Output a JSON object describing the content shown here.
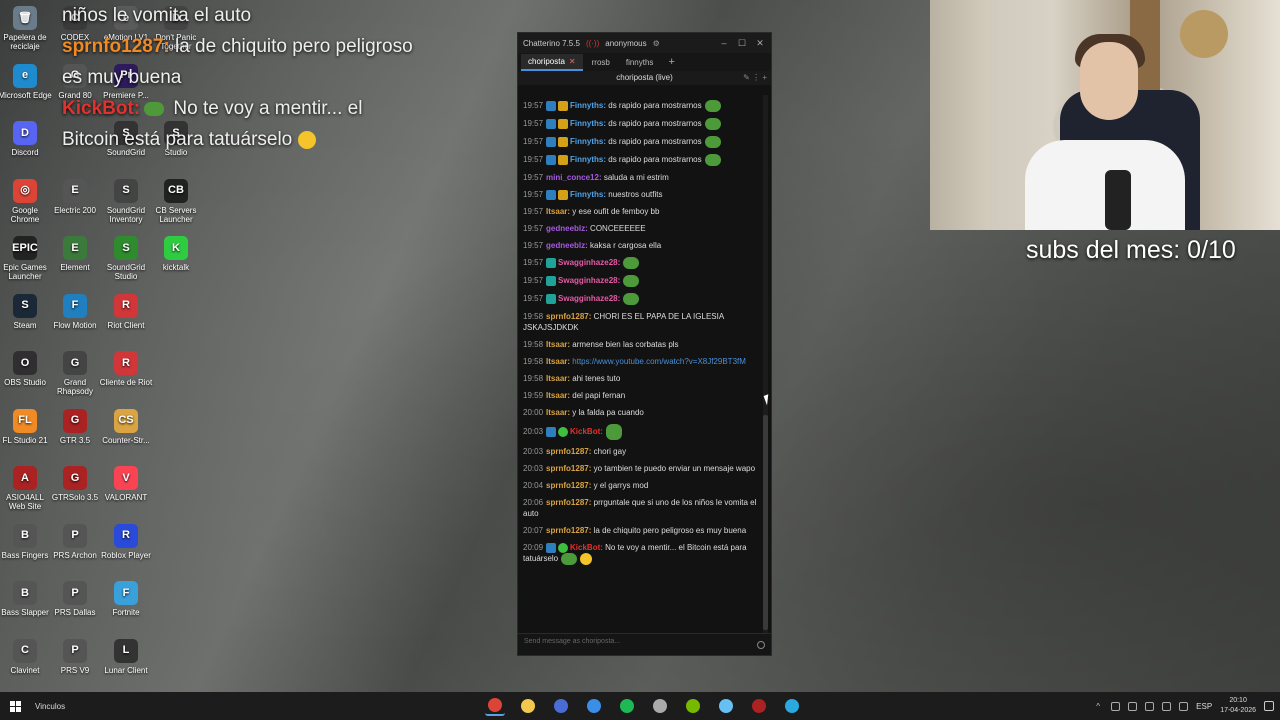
{
  "desktop_icons": [
    {
      "label": "Papelera de reciclaje",
      "color": "#6a7c8a",
      "glyph": "🗑"
    },
    {
      "label": "CODEX",
      "color": "#3a3a3a",
      "glyph": "C"
    },
    {
      "label": "eMotion LV1",
      "color": "#5a5a5a",
      "glyph": "e"
    },
    {
      "label": "Don't Panic Together",
      "color": "#444",
      "glyph": "D"
    },
    {
      "label": "Microsoft Edge",
      "color": "#1f8bcf",
      "glyph": "e"
    },
    {
      "label": "Grand 80",
      "color": "#555",
      "glyph": "G"
    },
    {
      "label": "Premiere P...",
      "color": "#2d1b5c",
      "glyph": "Pr"
    },
    {
      "label": "Discord",
      "color": "#5865f2",
      "glyph": "D"
    },
    {
      "label": "SoundGrid",
      "color": "#333",
      "glyph": "S"
    },
    {
      "label": "Studio",
      "color": "#333",
      "glyph": "S"
    },
    {
      "label": "Google Chrome",
      "color": "#db4437",
      "glyph": "◎"
    },
    {
      "label": "Electric 200",
      "color": "#555",
      "glyph": "E"
    },
    {
      "label": "SoundGrid Inventory",
      "color": "#444",
      "glyph": "S"
    },
    {
      "label": "CB Servers Launcher",
      "color": "#222",
      "glyph": "CB"
    },
    {
      "label": "Epic Games Launcher",
      "color": "#222",
      "glyph": "EPIC"
    },
    {
      "label": "Element",
      "color": "#3c7a3c",
      "glyph": "E"
    },
    {
      "label": "SoundGrid Studio",
      "color": "#2e8b2e",
      "glyph": "S"
    },
    {
      "label": "kicktalk",
      "color": "#2ecc40",
      "glyph": "K"
    },
    {
      "label": "Steam",
      "color": "#1b2838",
      "glyph": "S"
    },
    {
      "label": "Flow Motion",
      "color": "#1f7fbf",
      "glyph": "F"
    },
    {
      "label": "Riot Client",
      "color": "#d13639",
      "glyph": "R"
    },
    {
      "label": "OBS Studio",
      "color": "#302e31",
      "glyph": "O"
    },
    {
      "label": "Grand Rhapsody",
      "color": "#444",
      "glyph": "G"
    },
    {
      "label": "Cliente de Riot",
      "color": "#d13639",
      "glyph": "R"
    },
    {
      "label": "FL Studio 21",
      "color": "#f08a24",
      "glyph": "FL"
    },
    {
      "label": "GTR 3.5",
      "color": "#a22",
      "glyph": "G"
    },
    {
      "label": "Counter-Str...",
      "color": "#d9a441",
      "glyph": "CS"
    },
    {
      "label": "ASIO4ALL Web Site",
      "color": "#a22",
      "glyph": "A"
    },
    {
      "label": "GTRSolo 3.5",
      "color": "#a22",
      "glyph": "G"
    },
    {
      "label": "VALORANT",
      "color": "#fa4454",
      "glyph": "V"
    },
    {
      "label": "Bass Fingers",
      "color": "#555",
      "glyph": "B"
    },
    {
      "label": "PRS Archon",
      "color": "#555",
      "glyph": "P"
    },
    {
      "label": "Roblox Player",
      "color": "#2a4ad9",
      "glyph": "R"
    },
    {
      "label": "Bass Slapper",
      "color": "#555",
      "glyph": "B"
    },
    {
      "label": "PRS Dallas",
      "color": "#555",
      "glyph": "P"
    },
    {
      "label": "Fortnite",
      "color": "#3aa0d9",
      "glyph": "F"
    },
    {
      "label": "Clavinet",
      "color": "#555",
      "glyph": "C"
    },
    {
      "label": "PRS V9",
      "color": "#555",
      "glyph": "P"
    },
    {
      "label": "Lunar Client",
      "color": "#333",
      "glyph": "L"
    }
  ],
  "overlay": {
    "line1_text": "niños le vomita el auto",
    "line2_user": "sprnfo1287:",
    "line2_text": " la de chiquito pero peligroso",
    "line3_text": "es muy buena",
    "line4_user": "KickBot:",
    "line4_text": " No te voy a mentir... el",
    "line5_text": "Bitcoin está para tatuárselo"
  },
  "chatterino": {
    "title": "Chatterino 7.5.5",
    "account": "anonymous",
    "tabs": [
      {
        "label": "choriposta",
        "active": true
      },
      {
        "label": "rrosb",
        "active": false
      },
      {
        "label": "finnyths",
        "active": false
      }
    ],
    "split_title": "choriposta (live)",
    "input_placeholder": "Send message as choriposta...",
    "messages": [
      {
        "ts": "19:57",
        "badges": [
          "blue",
          "gold"
        ],
        "user": "Finnyths:",
        "ucls": "u-blue",
        "text": " ds rapido para mostrarnos",
        "emote": true
      },
      {
        "ts": "19:57",
        "badges": [
          "blue",
          "gold"
        ],
        "user": "Finnyths:",
        "ucls": "u-blue",
        "text": " ds rapido para mostrarnos",
        "emote": true
      },
      {
        "ts": "19:57",
        "badges": [
          "blue",
          "gold"
        ],
        "user": "Finnyths:",
        "ucls": "u-blue",
        "text": " ds rapido para mostrarnos",
        "emote": true
      },
      {
        "ts": "19:57",
        "badges": [
          "blue",
          "gold"
        ],
        "user": "Finnyths:",
        "ucls": "u-blue",
        "text": " ds rapido para mostrarnos",
        "emote": true
      },
      {
        "ts": "19:57",
        "badges": [],
        "user": "mini_conce12:",
        "ucls": "u-purple",
        "text": " saluda a mi estrim"
      },
      {
        "ts": "19:57",
        "badges": [
          "blue",
          "gold"
        ],
        "user": "Finnyths:",
        "ucls": "u-blue",
        "text": " nuestros outfits"
      },
      {
        "ts": "19:57",
        "badges": [],
        "user": "Itsaar:",
        "ucls": "u-gold",
        "text": " y ese oufit de femboy bb"
      },
      {
        "ts": "19:57",
        "badges": [],
        "user": "gedneeblz:",
        "ucls": "u-purple",
        "text": " CONCEEEEEE"
      },
      {
        "ts": "19:57",
        "badges": [],
        "user": "gedneeblz:",
        "ucls": "u-purple",
        "text": " kaksa r cargosa ella"
      },
      {
        "ts": "19:57",
        "badges": [
          "teal"
        ],
        "user": "Swagginhaze28:",
        "ucls": "u-pink",
        "text": "",
        "emote": true
      },
      {
        "ts": "19:57",
        "badges": [
          "teal"
        ],
        "user": "Swagginhaze28:",
        "ucls": "u-pink",
        "text": "",
        "emote": true
      },
      {
        "ts": "19:57",
        "badges": [
          "teal"
        ],
        "user": "Swagginhaze28:",
        "ucls": "u-pink",
        "text": "",
        "emote": true
      },
      {
        "ts": "19:58",
        "badges": [],
        "user": "sprnfo1287:",
        "ucls": "u-gold",
        "text": " CHORI ES EL PAPA DE LA IGLESIA JSKAJSJDKDK"
      },
      {
        "ts": "19:58",
        "badges": [],
        "user": "Itsaar:",
        "ucls": "u-gold",
        "text": " armense bien las corbatas pls"
      },
      {
        "ts": "19:58",
        "badges": [],
        "user": "Itsaar:",
        "ucls": "u-gold",
        "text": "",
        "link": " https://www.youtube.com/watch?v=X8Jf29BT3fM"
      },
      {
        "ts": "19:58",
        "badges": [],
        "user": "Itsaar:",
        "ucls": "u-gold",
        "text": " ahi tenes tuto"
      },
      {
        "ts": "19:59",
        "badges": [],
        "user": "Itsaar:",
        "ucls": "u-gold",
        "text": " del papi fernan"
      },
      {
        "ts": "20:00",
        "badges": [],
        "user": "Itsaar:",
        "ucls": "u-gold",
        "text": " y la falda pa cuando"
      },
      {
        "ts": "20:03",
        "badges": [
          "blue",
          "green"
        ],
        "user": "KickBot:",
        "ucls": "u-red",
        "text": "",
        "emote": true,
        "tall": true
      },
      {
        "ts": "20:03",
        "badges": [],
        "user": "sprnfo1287:",
        "ucls": "u-gold",
        "text": " chori gay"
      },
      {
        "ts": "20:03",
        "badges": [],
        "user": "sprnfo1287:",
        "ucls": "u-gold",
        "text": " yo tambien te puedo enviar un mensaje wapo"
      },
      {
        "ts": "20:04",
        "badges": [],
        "user": "sprnfo1287:",
        "ucls": "u-gold",
        "text": " y el garrys mod"
      },
      {
        "ts": "20:06",
        "badges": [],
        "user": "sprnfo1287:",
        "ucls": "u-gold",
        "text": " prrguntale que si uno de los niños le vomita el auto"
      },
      {
        "ts": "20:07",
        "badges": [],
        "user": "sprnfo1287:",
        "ucls": "u-gold",
        "text": " la de chiquito pero peligroso es muy buena"
      },
      {
        "ts": "20:09",
        "badges": [
          "blue",
          "green"
        ],
        "user": "KickBot:",
        "ucls": "u-red",
        "text": " No te voy a mentir... el Bitcoin está para tatuárselo",
        "emote": true,
        "emoji": true
      }
    ]
  },
  "subs_label": "subs del mes: 0/10",
  "taskbar": {
    "toolbar_label": "Vinculos",
    "apps": [
      {
        "name": "chrome",
        "color": "#db4437",
        "active": true
      },
      {
        "name": "file-explorer",
        "color": "#f2c94c",
        "active": false
      },
      {
        "name": "chrome-profile",
        "color": "#4a6cd4",
        "active": false
      },
      {
        "name": "calendar",
        "color": "#3a8ee6",
        "active": false
      },
      {
        "name": "spotify",
        "color": "#1db954",
        "active": false
      },
      {
        "name": "obs",
        "color": "#aaaaaa",
        "active": false
      },
      {
        "name": "nvidia",
        "color": "#76b900",
        "active": false
      },
      {
        "name": "steam",
        "color": "#66c0f4",
        "active": false
      },
      {
        "name": "chatterino",
        "color": "#aa2222",
        "active": false
      },
      {
        "name": "browser",
        "color": "#2aa8e0",
        "active": false
      }
    ],
    "language": "ESP",
    "time": "20:10",
    "date": "17-04-2026"
  }
}
